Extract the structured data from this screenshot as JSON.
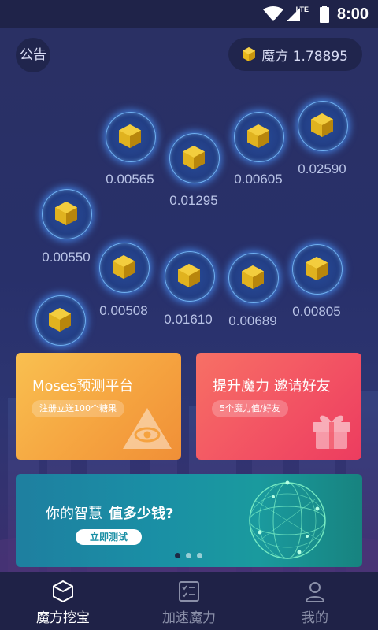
{
  "status_bar": {
    "network": "LTE",
    "time": "8:00"
  },
  "header": {
    "notice_label": "公告",
    "balance_label": "魔方 1.78895"
  },
  "orbs": [
    {
      "value": "0.00565"
    },
    {
      "value": "0.01295"
    },
    {
      "value": "0.00605"
    },
    {
      "value": "0.02590"
    },
    {
      "value": "0.00550"
    },
    {
      "value": "0.00508"
    },
    {
      "value": "0.01610"
    },
    {
      "value": "0.00689"
    },
    {
      "value": "0.00805"
    },
    {
      "value": ""
    }
  ],
  "cards": {
    "prediction": {
      "title": "Moses预测平台",
      "chip": "注册立送100个糖果"
    },
    "invite": {
      "title": "提升魔力 邀请好友",
      "chip": "5个魔力值/好友"
    }
  },
  "banner": {
    "text_prefix": "你的智慧",
    "text_emphasis": "值多少钱?",
    "button": "立即测试",
    "active_page": 1,
    "pages": 3
  },
  "bottom_nav": [
    {
      "label": "魔方挖宝",
      "active": true
    },
    {
      "label": "加速魔力",
      "active": false
    },
    {
      "label": "我的",
      "active": false
    }
  ],
  "colors": {
    "accent": "#e6b71d",
    "card_orange": "#f5a23f",
    "card_red": "#f25063",
    "banner_teal": "#1a8fa5"
  }
}
